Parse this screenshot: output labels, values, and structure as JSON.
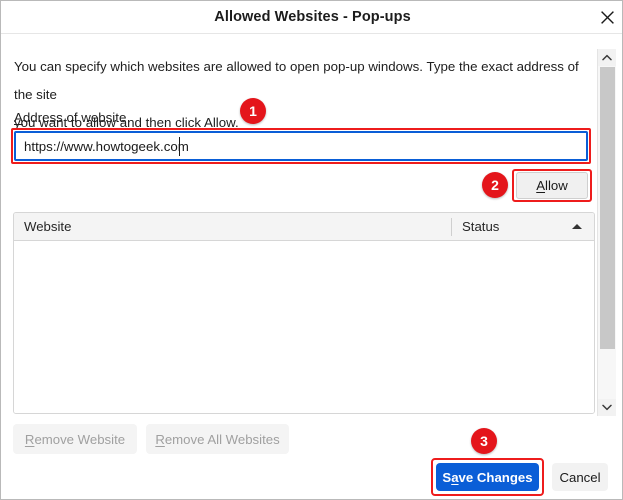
{
  "dialog": {
    "title": "Allowed Websites - Pop-ups",
    "close_icon": "close-icon"
  },
  "content": {
    "description_line1": "You can specify which websites are allowed to open pop-up windows. Type the exact address of the site",
    "description_line2": "you want to allow and then click Allow.",
    "field_label": "Address of website",
    "field_label_accel": "A",
    "field_label_rest": "ddress of website"
  },
  "address_field": {
    "value": "https://www.howtogeek.com",
    "placeholder": ""
  },
  "allow_button": {
    "accel": "A",
    "rest": "llow"
  },
  "table": {
    "columns": [
      {
        "label": "Website"
      },
      {
        "label": "Status"
      }
    ],
    "sort_indicator": "ascending",
    "rows": []
  },
  "scrollbar": {
    "up_icon": "chevron-up-icon",
    "down_icon": "chevron-down-icon"
  },
  "remove_buttons": {
    "remove_website": {
      "accel": "R",
      "rest": "emove Website",
      "enabled": false
    },
    "remove_all": {
      "accel": "R",
      "rest": "emove All Websites",
      "enabled": false
    }
  },
  "footer": {
    "save": {
      "pre": "S",
      "accel": "a",
      "rest": "ve Changes"
    },
    "cancel": "Cancel"
  },
  "badges": {
    "one": "1",
    "two": "2",
    "three": "3"
  },
  "colors": {
    "accent_blue": "#0a5ed7",
    "highlight_red": "#ee1c1c",
    "badge_red": "#e4151b",
    "header_grey": "#f4f4f4"
  }
}
